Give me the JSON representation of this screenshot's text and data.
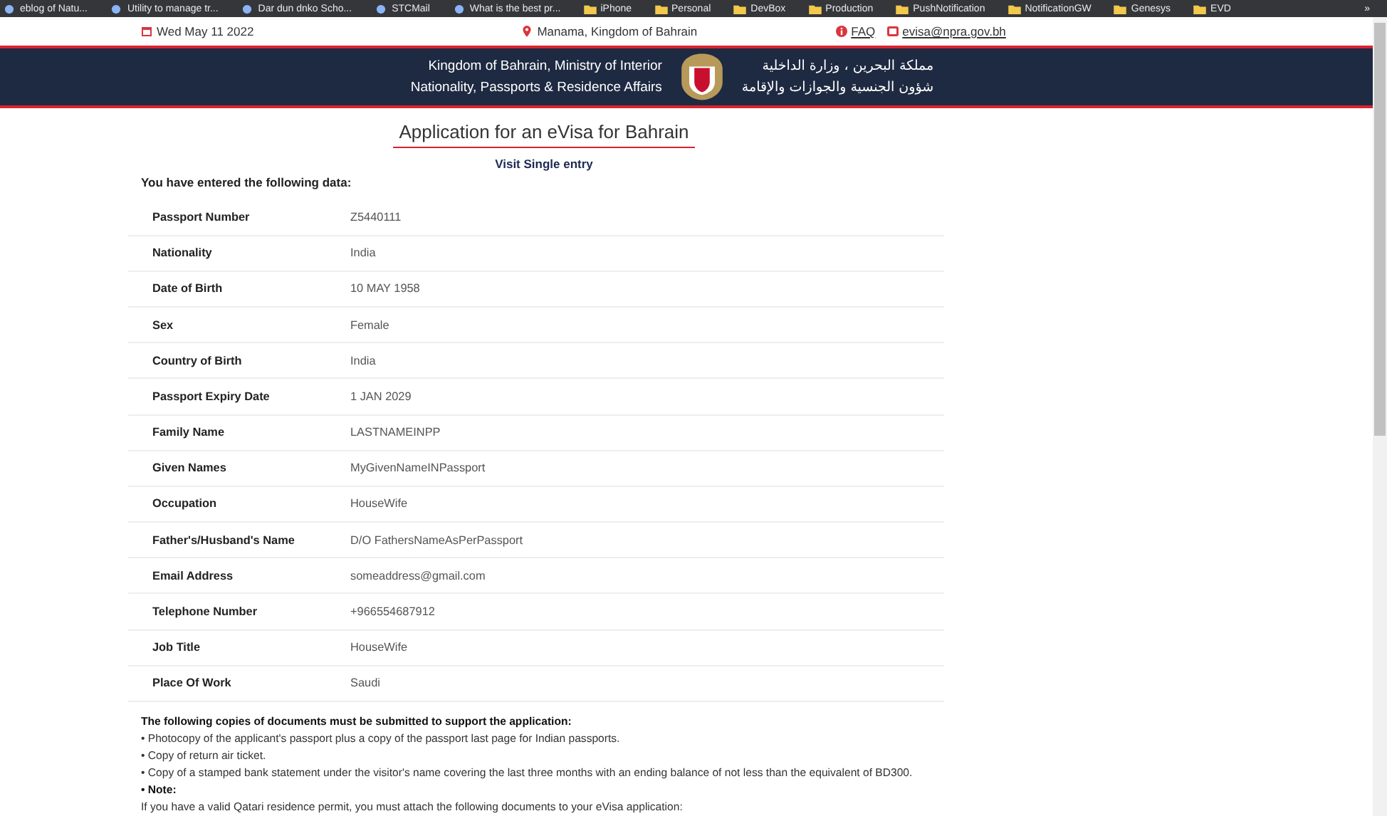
{
  "bookmarks": [
    {
      "label": "eblog of Natu..."
    },
    {
      "label": "Utility to manage tr..."
    },
    {
      "label": "Dar dun dnko Scho..."
    },
    {
      "label": "STCMail"
    },
    {
      "label": "What is the best pr..."
    },
    {
      "label": "iPhone"
    },
    {
      "label": "Personal"
    },
    {
      "label": "DevBox"
    },
    {
      "label": "Production"
    },
    {
      "label": "PushNotification"
    },
    {
      "label": "NotificationGW"
    },
    {
      "label": "Genesys"
    },
    {
      "label": "EVD"
    }
  ],
  "bookmarks_more": "»",
  "info_bar": {
    "date": "Wed May 11 2022",
    "location": "Manama, Kingdom of Bahrain",
    "faq": "FAQ",
    "email": "evisa@npra.gov.bh"
  },
  "header": {
    "english_lines": [
      "Kingdom of Bahrain, Ministry of Interior",
      "Nationality, Passports & Residence Affairs"
    ],
    "arabic_lines": [
      "مملكة البحرين ، وزارة الداخلية",
      "شؤون الجنسية والجوازات والإقامة"
    ]
  },
  "title": "Application for an eVisa for Bahrain",
  "subtitle": "Visit Single entry",
  "intro": "You have entered the following data:",
  "rows": [
    {
      "label": "Passport Number",
      "value": "Z5440111"
    },
    {
      "label": "Nationality",
      "value": "India"
    },
    {
      "label": "Date of Birth",
      "value": "10 MAY 1958"
    },
    {
      "label": "Sex",
      "value": "Female"
    },
    {
      "label": "Country of Birth",
      "value": "India"
    },
    {
      "label": "Passport Expiry Date",
      "value": "1 JAN 2029"
    },
    {
      "label": "Family Name",
      "value": "LASTNAMEINPP"
    },
    {
      "label": "Given Names",
      "value": "MyGivenNameINPassport"
    },
    {
      "label": "Occupation",
      "value": "HouseWife"
    },
    {
      "label": "Father's/Husband's Name",
      "value": "D/O FathersNameAsPerPassport"
    },
    {
      "label": "Email Address",
      "value": "someaddress@gmail.com"
    },
    {
      "label": "Telephone Number",
      "value": "+966554687912"
    },
    {
      "label": "Job Title",
      "value": "HouseWife"
    },
    {
      "label": "Place Of Work",
      "value": "Saudi"
    }
  ],
  "notes": [
    {
      "kind": "heading",
      "text": "The following copies of documents must be submitted to support the application:"
    },
    {
      "kind": "item",
      "text": "• Photocopy of the applicant's passport plus a copy of the passport last page for Indian passports."
    },
    {
      "kind": "item",
      "text": "• Copy of return air ticket."
    },
    {
      "kind": "item",
      "text": "• Copy of a stamped bank statement under the visitor's name covering the last three months with an ending balance of not less than the equivalent of BD300."
    },
    {
      "kind": "heading",
      "text": "• Note:"
    },
    {
      "kind": "item",
      "text": "If you have a valid Qatari residence permit, you must attach the following documents to your eVisa application:"
    }
  ]
}
